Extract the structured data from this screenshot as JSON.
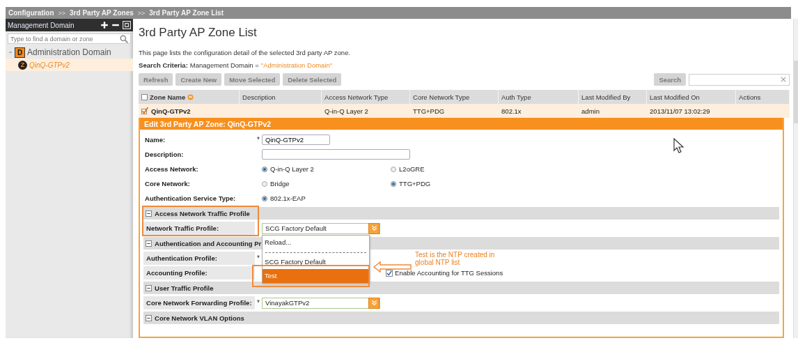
{
  "breadcrumb": [
    "Configuration",
    ">>",
    "3rd Party AP Zones",
    ">>",
    "3rd Party AP Zone List"
  ],
  "sidebar": {
    "title": "Management Domain",
    "search": {
      "placeholder": "Type to find a domain or zone"
    },
    "tree": [
      {
        "label": "Administration Domain",
        "badge": "D",
        "expanded": true,
        "selected": false,
        "children": [
          {
            "label": "QinQ-GTPv2",
            "badge": "Z",
            "selected": true
          }
        ]
      }
    ]
  },
  "page": {
    "title": "3rd Party AP Zone List",
    "description": "This page lists the configuration detail of the selected 3rd party AP zone.",
    "criteria_label": "Search Criteria:",
    "criteria_text": "Management Domain = ",
    "criteria_value": "\"Administration Domain\""
  },
  "toolbar": [
    {
      "label": "Refresh",
      "disabled": true
    },
    {
      "label": "Create New",
      "disabled": true
    },
    {
      "label": "Move Selected",
      "disabled": true
    },
    {
      "label": "Delete Selected",
      "disabled": true
    }
  ],
  "search_button": {
    "label": "Search",
    "disabled": true
  },
  "table": {
    "all_checked": false,
    "columns": [
      {
        "label": "Zone Name",
        "sorted": true
      },
      {
        "label": "Description",
        "sorted": false
      },
      {
        "label": "Access Network Type",
        "sorted": false
      },
      {
        "label": "Core Network Type",
        "sorted": false
      },
      {
        "label": "Auth Type",
        "sorted": false
      },
      {
        "label": "Last Modified By",
        "sorted": false
      },
      {
        "label": "Last Modified On",
        "sorted": false
      },
      {
        "label": "Actions",
        "sorted": false
      }
    ],
    "rows": [
      {
        "selected": true,
        "checked": true,
        "cells": [
          "QinQ-GTPv2",
          "",
          "Q-in-Q Layer 2",
          "TTG+PDG",
          "802.1x",
          "admin",
          "2013/11/07 13:02:29",
          ""
        ]
      }
    ]
  },
  "edit_panel": {
    "title": "Edit 3rd Party AP Zone: QinQ-GTPv2",
    "fields": [
      {
        "kind": "text",
        "label": "Name:",
        "required_mark": "*",
        "value": "QinQ-GTPv2"
      },
      {
        "kind": "text",
        "label": "Description:"
      },
      {
        "kind": "radio",
        "label": "Access Network:",
        "options": [
          {
            "label": "Q-in-Q Layer 2",
            "selected": true
          },
          {
            "label": "L2oGRE",
            "selected": false
          }
        ]
      },
      {
        "kind": "radio",
        "label": "Core Network:",
        "options": [
          {
            "label": "Bridge",
            "selected": false
          },
          {
            "label": "TTG+PDG",
            "selected": true
          }
        ]
      },
      {
        "kind": "radio",
        "label": "Authentication Service Type:",
        "options": [
          {
            "label": "802.1x-EAP",
            "selected": true
          }
        ]
      },
      {
        "kind": "section",
        "label": "Access Network Traffic Profile",
        "expanded": true
      },
      {
        "kind": "select",
        "label": "Network Traffic Profile:",
        "value": "SCG Factory Default",
        "open": true,
        "options": [
          {
            "label": "Reload...",
            "highlighted": false
          },
          {
            "label": "SCG Factory Default",
            "highlighted": false
          },
          {
            "label": "Test",
            "highlighted": true
          }
        ]
      },
      {
        "kind": "section",
        "label": "Authentication and Accounting Pr",
        "expanded": true
      },
      {
        "kind": "select",
        "label": "Authentication Profile:",
        "required_mark": "*"
      },
      {
        "kind": "select",
        "label": "Accounting Profile:",
        "checkbox": {
          "label": "Enable Accounting for TTG Sessions",
          "checked": true
        }
      },
      {
        "kind": "section",
        "label": "User Traffic Profile",
        "expanded": true
      },
      {
        "kind": "select",
        "label": "Core Network Forwarding Profile:",
        "required_mark": "*",
        "value": "VinayakGTPv2"
      },
      {
        "kind": "section",
        "label": "Core Network VLAN Options",
        "expanded": true
      }
    ]
  },
  "annotation": {
    "note": "Test is the NTP created in global NTP list"
  }
}
